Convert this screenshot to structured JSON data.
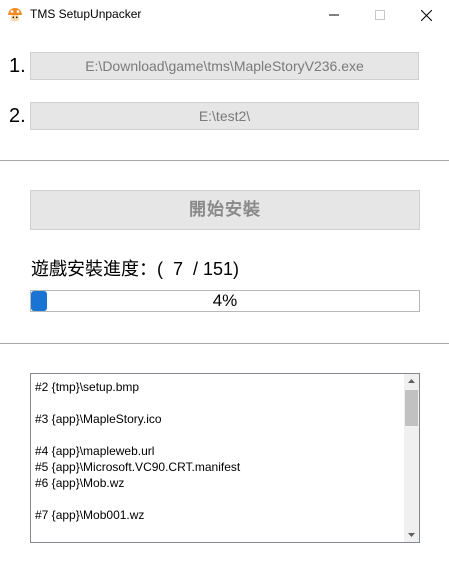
{
  "window": {
    "title": "TMS SetupUnpacker",
    "icon": "maplestory-mushroom-icon"
  },
  "steps": [
    {
      "number": "1.",
      "path": "E:\\Download\\game\\tms\\MapleStoryV236.exe"
    },
    {
      "number": "2.",
      "path": "E:\\test2\\"
    }
  ],
  "install_button": {
    "label": "開始安裝"
  },
  "progress": {
    "label": "遊戲安裝進度：(  7  / 151)",
    "current": 7,
    "total": 151,
    "percent_text": "4%",
    "fraction": 0.04,
    "fill_color": "#1a74d4"
  },
  "log": {
    "lines": [
      "#2 {tmp}\\setup.bmp",
      "",
      "#3 {app}\\MapleStory.ico",
      "",
      "#4 {app}\\mapleweb.url",
      "#5 {app}\\Microsoft.VC90.CRT.manifest",
      "#6 {app}\\Mob.wz",
      "",
      "#7 {app}\\Mob001.wz"
    ]
  }
}
